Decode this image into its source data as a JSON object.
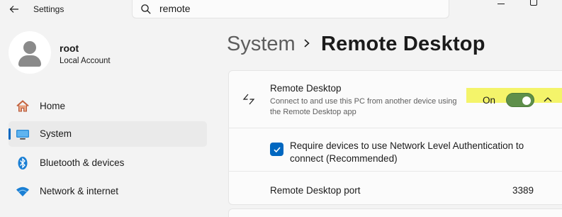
{
  "window": {
    "app_title": "Settings"
  },
  "search": {
    "value": "remote"
  },
  "profile": {
    "name": "root",
    "account_type": "Local Account"
  },
  "sidebar": {
    "items": [
      {
        "label": "Home",
        "icon": "home-icon",
        "selected": false
      },
      {
        "label": "System",
        "icon": "system-icon",
        "selected": true
      },
      {
        "label": "Bluetooth & devices",
        "icon": "bluetooth-icon",
        "selected": false
      },
      {
        "label": "Network & internet",
        "icon": "wifi-icon",
        "selected": false
      }
    ]
  },
  "breadcrumb": {
    "root": "System",
    "current": "Remote Desktop"
  },
  "remote_desktop": {
    "title": "Remote Desktop",
    "description": "Connect to and use this PC from another device using the Remote Desktop app",
    "toggle_state": "On",
    "enabled": true
  },
  "nla": {
    "checked": true,
    "label": "Require devices to use Network Level Authentication to connect (Recommended)"
  },
  "port": {
    "label": "Remote Desktop port",
    "value": "3389"
  },
  "colors": {
    "accent": "#0067c0",
    "toggle_on": "#5e8f4a",
    "highlight": "#f4f46a"
  }
}
